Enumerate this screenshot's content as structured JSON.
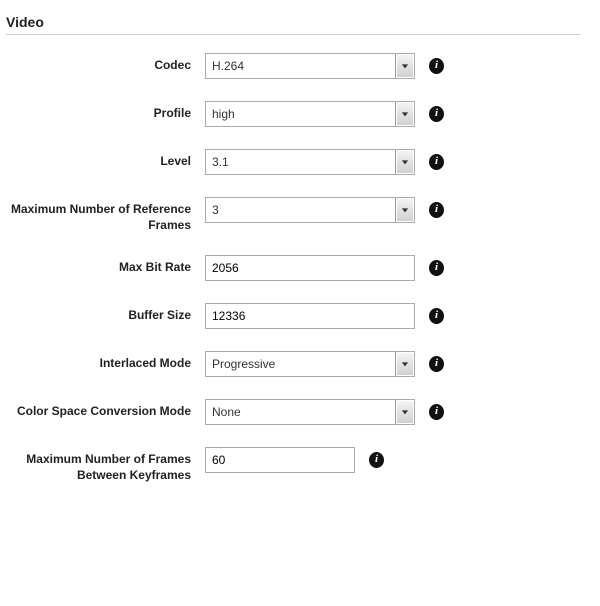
{
  "section_title": "Video",
  "fields": {
    "codec": {
      "label": "Codec",
      "value": "H.264",
      "type": "select"
    },
    "profile": {
      "label": "Profile",
      "value": "high",
      "type": "select"
    },
    "level": {
      "label": "Level",
      "value": "3.1",
      "type": "select"
    },
    "maxref": {
      "label": "Maximum Number of Reference Frames",
      "value": "3",
      "type": "select"
    },
    "maxbit": {
      "label": "Max Bit Rate",
      "value": "2056",
      "type": "text"
    },
    "buffer": {
      "label": "Buffer Size",
      "value": "12336",
      "type": "text"
    },
    "interl": {
      "label": "Interlaced Mode",
      "value": "Progressive",
      "type": "select"
    },
    "csc": {
      "label": "Color Space Conversion Mode",
      "value": "None",
      "type": "select"
    },
    "maxkey": {
      "label": "Maximum Number of Frames Between Keyframes",
      "value": "60",
      "type": "text",
      "narrow": true
    }
  },
  "info_glyph": "i"
}
